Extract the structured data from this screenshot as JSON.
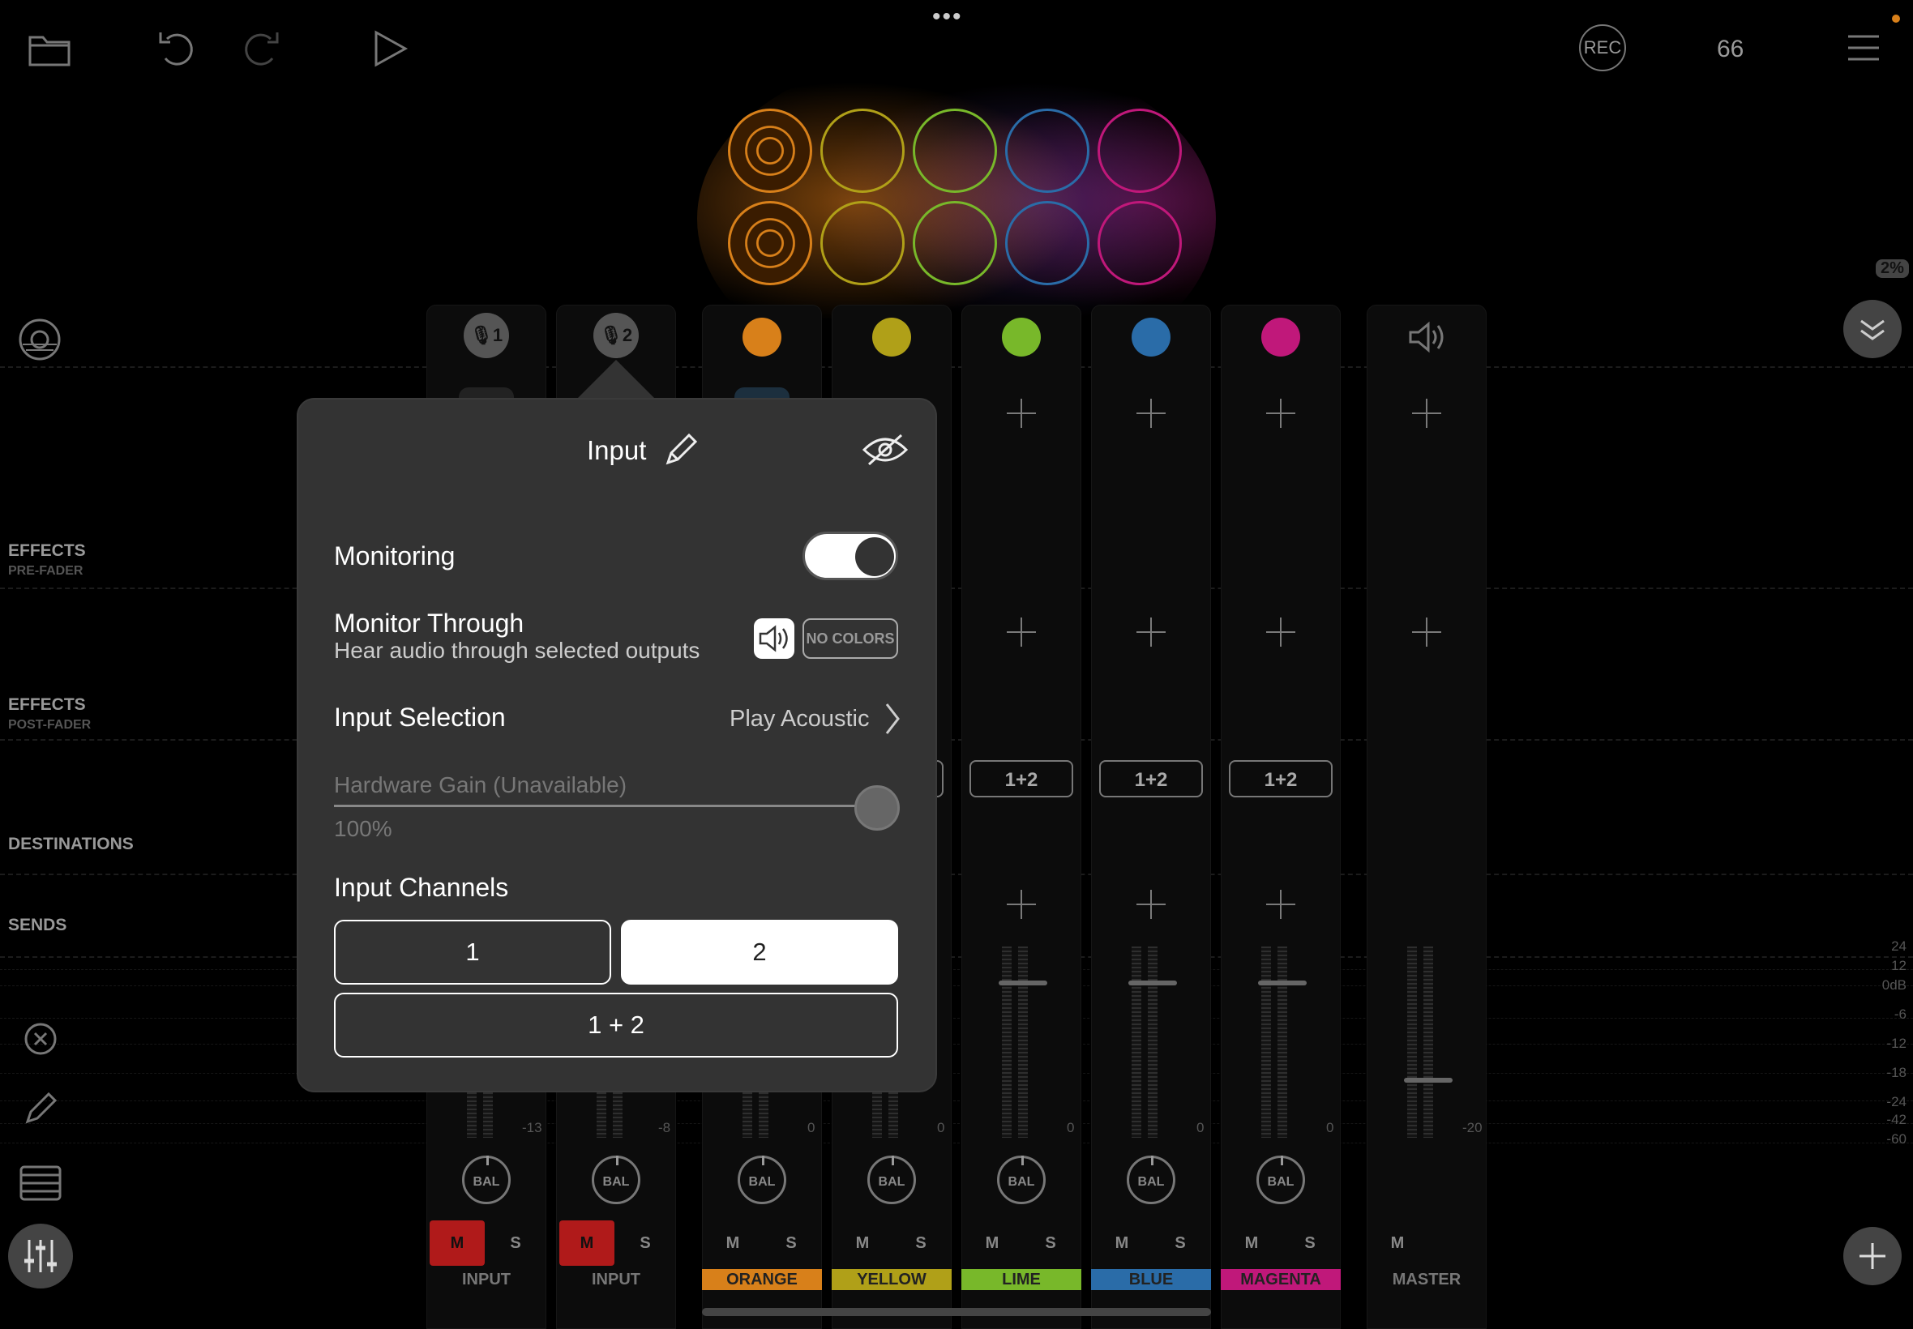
{
  "toolbar": {
    "more_dots": "•••",
    "rec_label": "REC",
    "tempo": "66",
    "percent_badge": "2%"
  },
  "sections": {
    "effects_pre": "EFFECTS",
    "effects_pre_sub": "PRE-FADER",
    "effects_post": "EFFECTS",
    "effects_post_sub": "POST-FADER",
    "destinations": "DESTINATIONS",
    "sends": "SENDS"
  },
  "channels": [
    {
      "label": "INPUT",
      "db": "-13",
      "mute": "M",
      "solo": "S",
      "bal": "BAL",
      "mic": "1"
    },
    {
      "label": "INPUT",
      "db": "-8",
      "mute": "M",
      "solo": "S",
      "bal": "BAL",
      "mic": "2"
    },
    {
      "label": "ORANGE",
      "db": "0",
      "mute": "M",
      "solo": "S",
      "bal": "BAL",
      "color": "#d8801a"
    },
    {
      "label": "YELLOW",
      "db": "0",
      "mute": "M",
      "solo": "S",
      "bal": "BAL",
      "color": "#b0a018"
    },
    {
      "label": "LIME",
      "db": "0",
      "mute": "M",
      "solo": "S",
      "bal": "BAL",
      "color": "#78b82a",
      "route": "1+2"
    },
    {
      "label": "BLUE",
      "db": "0",
      "mute": "M",
      "solo": "S",
      "bal": "BAL",
      "color": "#2a6ca8",
      "route": "1+2"
    },
    {
      "label": "MAGENTA",
      "db": "0",
      "mute": "M",
      "solo": "S",
      "bal": "BAL",
      "color": "#c0187a",
      "route": "1+2"
    },
    {
      "label": "MASTER",
      "db": "-20",
      "mute": "M"
    }
  ],
  "db_scale": [
    "24",
    "12",
    "0dB",
    "-6",
    "-12",
    "-18",
    "-24",
    "-42",
    "-60"
  ],
  "popup": {
    "title": "Input",
    "monitoring_label": "Monitoring",
    "monitoring_on": true,
    "monitor_through_label": "Monitor Through",
    "monitor_through_sub": "Hear audio through selected outputs",
    "no_colors_label": "NO COLORS",
    "input_selection_label": "Input Selection",
    "input_selection_value": "Play Acoustic",
    "hardware_gain_label": "Hardware Gain (Unavailable)",
    "hardware_gain_value": "100%",
    "input_channels_label": "Input Channels",
    "channel_options": [
      "1",
      "2",
      "1 + 2"
    ],
    "selected_channel": "2"
  },
  "colors": {
    "orange": "#d8801a",
    "yellow": "#b0a018",
    "lime": "#78b82a",
    "blue": "#2a6ca8",
    "magenta": "#c0187a",
    "mute_active": "#b01a1a",
    "popup_bg": "#333333"
  }
}
